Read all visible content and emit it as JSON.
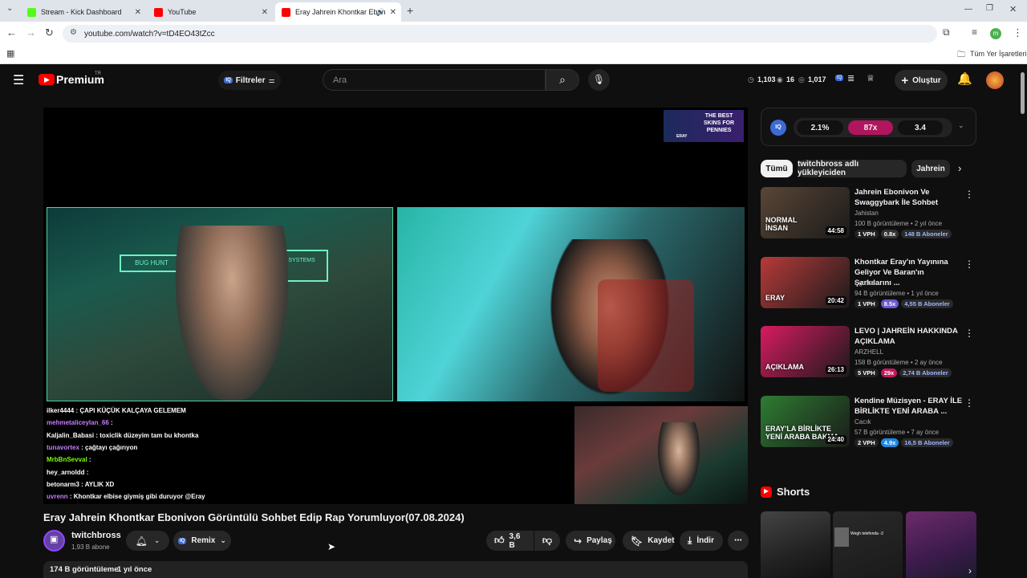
{
  "browser": {
    "tabs": [
      {
        "label": "Stream - Kick Dashboard",
        "favicon_color": "#53fc18"
      },
      {
        "label": "YouTube",
        "favicon_color": "#ff0000"
      },
      {
        "label": "Eray Jahrein Khontkar Ebon",
        "favicon_color": "#ff0000"
      }
    ],
    "new_tab_icon": "plus-icon",
    "url": "youtube.com/watch?v=tD4EO43tZcc",
    "bookmarks_label": "Tüm Yer İşaretleri"
  },
  "header": {
    "logo_text": "Premium",
    "logo_region": "TR",
    "filters_label": "Filtreler",
    "search_placeholder": "Ara",
    "stats": [
      "1,103",
      "16",
      "1,017"
    ],
    "create_label": "Oluştur"
  },
  "player": {
    "ad_lines": [
      "THE BEST",
      "SKINS FOR",
      "PENNIES"
    ],
    "ad_tag": "ERAY",
    "chat": [
      {
        "user": "ilker4444",
        "text": " : ÇAPI KÜÇÜK KALÇAYA GELEMEM",
        "color": "#ffffff"
      },
      {
        "user": "mehmetaliceylan_66",
        "text": " : ",
        "color": "#c77dff"
      },
      {
        "user": "Kaljalin_Babasi",
        "text": " : toxiclik düzeyim tam bu khontka",
        "color": "#ffffff"
      },
      {
        "user": "tunavortex",
        "text": " : çağtayı çağırıyon",
        "color": "#c77dff"
      },
      {
        "user": "MrbBnSevval",
        "text": " : ",
        "color": "#7cfc00"
      },
      {
        "user": "hey_arnoldd",
        "text": " : ",
        "color": "#ffffff"
      },
      {
        "user": "betonarm3",
        "text": " : AYLIK XD",
        "color": "#ffffff"
      },
      {
        "user": "uvrenn",
        "text": " : Khontkar elbise giymiş gibi duruyor @Eray",
        "color": "#c77dff"
      }
    ]
  },
  "video": {
    "title": "Eray Jahrein Khontkar Ebonivon Görüntülü Sohbet Edip Rap Yorumluyor(07.08.2024)",
    "channel": "twitchbross",
    "subscribers": "1,93 B abone",
    "remix_label": "Remix",
    "likes": "3,6 B",
    "share_label": "Paylaş",
    "save_label": "Kaydet",
    "download_label": "İndir",
    "views": "174 B görüntüleme",
    "age": "1 yıl önce"
  },
  "sidebar": {
    "metrics": [
      "2.1%",
      "87x",
      "3.4"
    ],
    "chips": [
      "Tümü",
      "twitchbross adlı yükleyiciden",
      "Jahrein"
    ],
    "videos": [
      {
        "title": "Jahrein Ebonivon Ve Swaggybark İle Sohbet",
        "channel": "Jahistan",
        "meta": "100 B görüntüleme • 2 yıl önce",
        "duration": "44:58",
        "vph": "1 VPH",
        "mult": "0.8x",
        "mult_color": "#333333",
        "subs": "148 B Aboneler",
        "thumb_text": "NORMAL\nİNSAN",
        "thumb_color": "#5a4636"
      },
      {
        "title": "Khontkar Eray'ın Yayınına Geliyor Ve Baran'ın Şarkılarını ...",
        "channel": "Egolee",
        "meta": "94 B görüntüleme • 1 yıl önce",
        "duration": "20:42",
        "vph": "1 VPH",
        "mult": "8.5x",
        "mult_color": "#6a5acd",
        "subs": "4,55 B Aboneler",
        "thumb_text": "ERAY",
        "thumb_color": "#b83a3a"
      },
      {
        "title": "LEVO | JAHREİN HAKKINDA AÇIKLAMA",
        "channel": "ARZHELL",
        "meta": "158 B görüntüleme • 2 ay önce",
        "duration": "26:13",
        "vph": "5 VPH",
        "mult": "29x",
        "mult_color": "#c2185b",
        "subs": "2,74 B Aboneler",
        "thumb_text": "AÇIKLAMA",
        "thumb_color": "#d81b60"
      },
      {
        "title": "Kendine Müzisyen - ERAY İLE BİRLİKTE YENİ ARABA ...",
        "channel": "Cacık",
        "meta": "57 B görüntüleme • 7 ay önce",
        "duration": "24:40",
        "vph": "2 VPH",
        "mult": "4.9x",
        "mult_color": "#1e88e5",
        "subs": "16,5 B Aboneler",
        "thumb_text": "ERAY'LA BİRLİKTE\nYENİ ARABA BAKMA",
        "thumb_color": "#2e7d32"
      }
    ],
    "shorts_label": "Shorts",
    "shorts_caption": "Wegh telefonda -3"
  }
}
